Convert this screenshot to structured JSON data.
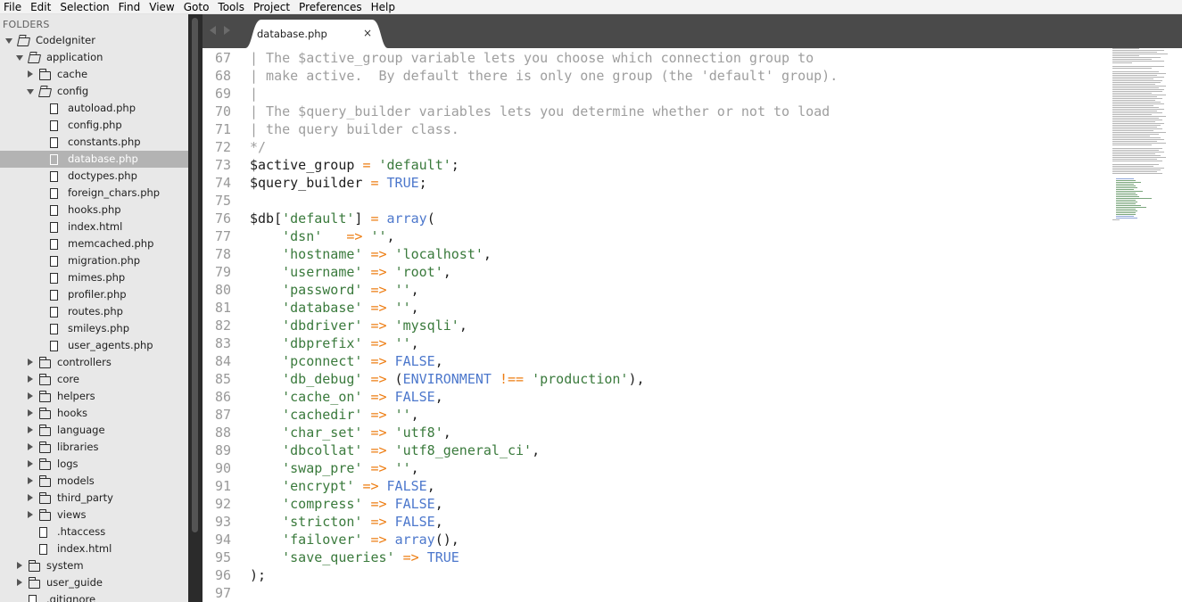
{
  "menu": [
    "File",
    "Edit",
    "Selection",
    "Find",
    "View",
    "Goto",
    "Tools",
    "Project",
    "Preferences",
    "Help"
  ],
  "sidebar": {
    "header": "FOLDERS",
    "tree": [
      {
        "label": "CodeIgniter",
        "type": "folder",
        "expanded": true,
        "depth": 0
      },
      {
        "label": "application",
        "type": "folder",
        "expanded": true,
        "depth": 1
      },
      {
        "label": "cache",
        "type": "folder",
        "expanded": false,
        "depth": 2
      },
      {
        "label": "config",
        "type": "folder",
        "expanded": true,
        "depth": 2
      },
      {
        "label": "autoload.php",
        "type": "file",
        "depth": 3
      },
      {
        "label": "config.php",
        "type": "file",
        "depth": 3
      },
      {
        "label": "constants.php",
        "type": "file",
        "depth": 3
      },
      {
        "label": "database.php",
        "type": "file",
        "depth": 3,
        "selected": true
      },
      {
        "label": "doctypes.php",
        "type": "file",
        "depth": 3
      },
      {
        "label": "foreign_chars.php",
        "type": "file",
        "depth": 3
      },
      {
        "label": "hooks.php",
        "type": "file",
        "depth": 3
      },
      {
        "label": "index.html",
        "type": "file",
        "depth": 3
      },
      {
        "label": "memcached.php",
        "type": "file",
        "depth": 3
      },
      {
        "label": "migration.php",
        "type": "file",
        "depth": 3
      },
      {
        "label": "mimes.php",
        "type": "file",
        "depth": 3
      },
      {
        "label": "profiler.php",
        "type": "file",
        "depth": 3
      },
      {
        "label": "routes.php",
        "type": "file",
        "depth": 3
      },
      {
        "label": "smileys.php",
        "type": "file",
        "depth": 3
      },
      {
        "label": "user_agents.php",
        "type": "file",
        "depth": 3
      },
      {
        "label": "controllers",
        "type": "folder",
        "expanded": false,
        "depth": 2
      },
      {
        "label": "core",
        "type": "folder",
        "expanded": false,
        "depth": 2
      },
      {
        "label": "helpers",
        "type": "folder",
        "expanded": false,
        "depth": 2
      },
      {
        "label": "hooks",
        "type": "folder",
        "expanded": false,
        "depth": 2
      },
      {
        "label": "language",
        "type": "folder",
        "expanded": false,
        "depth": 2
      },
      {
        "label": "libraries",
        "type": "folder",
        "expanded": false,
        "depth": 2
      },
      {
        "label": "logs",
        "type": "folder",
        "expanded": false,
        "depth": 2
      },
      {
        "label": "models",
        "type": "folder",
        "expanded": false,
        "depth": 2
      },
      {
        "label": "third_party",
        "type": "folder",
        "expanded": false,
        "depth": 2
      },
      {
        "label": "views",
        "type": "folder",
        "expanded": false,
        "depth": 2
      },
      {
        "label": ".htaccess",
        "type": "file",
        "depth": 2
      },
      {
        "label": "index.html",
        "type": "file",
        "depth": 2
      },
      {
        "label": "system",
        "type": "folder",
        "expanded": false,
        "depth": 1
      },
      {
        "label": "user_guide",
        "type": "folder",
        "expanded": false,
        "depth": 1
      },
      {
        "label": ".gitignore",
        "type": "file",
        "depth": 1
      }
    ]
  },
  "tab": {
    "title": "database.php",
    "close": "×"
  },
  "colors": {
    "comment": "#9e9e9e",
    "string": "#3a7a3c",
    "operator": "#ed7d12",
    "keyword": "#4d78cc",
    "line_number": "#999999",
    "sidebar_bg": "#e8e8e8",
    "tabbar_bg": "#4a4a4a"
  },
  "editor": {
    "lines": [
      {
        "n": "67",
        "t": [
          [
            "c",
            "| The $active_group variable lets you choose which connection group to"
          ]
        ]
      },
      {
        "n": "68",
        "t": [
          [
            "c",
            "| make active.  By default there is only one group (the 'default' group)."
          ]
        ]
      },
      {
        "n": "69",
        "t": [
          [
            "c",
            "|"
          ]
        ]
      },
      {
        "n": "70",
        "t": [
          [
            "c",
            "| The $query_builder variables lets you determine whether or not to load"
          ]
        ]
      },
      {
        "n": "71",
        "t": [
          [
            "c",
            "| the query builder class."
          ]
        ]
      },
      {
        "n": "72",
        "t": [
          [
            "c",
            "*/"
          ]
        ]
      },
      {
        "n": "73",
        "t": [
          [
            "v",
            "$active_group"
          ],
          [
            "p",
            " "
          ],
          [
            "o",
            "="
          ],
          [
            "p",
            " "
          ],
          [
            "s",
            "'default'"
          ],
          [
            "p",
            ";"
          ]
        ]
      },
      {
        "n": "74",
        "t": [
          [
            "v",
            "$query_builder"
          ],
          [
            "p",
            " "
          ],
          [
            "o",
            "="
          ],
          [
            "p",
            " "
          ],
          [
            "k",
            "TRUE"
          ],
          [
            "p",
            ";"
          ]
        ]
      },
      {
        "n": "75",
        "t": []
      },
      {
        "n": "76",
        "t": [
          [
            "v",
            "$db"
          ],
          [
            "p",
            "["
          ],
          [
            "s",
            "'default'"
          ],
          [
            "p",
            "] "
          ],
          [
            "o",
            "="
          ],
          [
            "p",
            " "
          ],
          [
            "k",
            "array"
          ],
          [
            "p",
            "("
          ]
        ]
      },
      {
        "n": "77",
        "t": [
          [
            "p",
            "    "
          ],
          [
            "s",
            "'dsn'"
          ],
          [
            "p",
            "   "
          ],
          [
            "o",
            "=>"
          ],
          [
            "p",
            " "
          ],
          [
            "s",
            "''"
          ],
          [
            "p",
            ","
          ]
        ]
      },
      {
        "n": "78",
        "t": [
          [
            "p",
            "    "
          ],
          [
            "s",
            "'hostname'"
          ],
          [
            "p",
            " "
          ],
          [
            "o",
            "=>"
          ],
          [
            "p",
            " "
          ],
          [
            "s",
            "'localhost'"
          ],
          [
            "p",
            ","
          ]
        ]
      },
      {
        "n": "79",
        "t": [
          [
            "p",
            "    "
          ],
          [
            "s",
            "'username'"
          ],
          [
            "p",
            " "
          ],
          [
            "o",
            "=>"
          ],
          [
            "p",
            " "
          ],
          [
            "s",
            "'root'"
          ],
          [
            "p",
            ","
          ]
        ]
      },
      {
        "n": "80",
        "t": [
          [
            "p",
            "    "
          ],
          [
            "s",
            "'password'"
          ],
          [
            "p",
            " "
          ],
          [
            "o",
            "=>"
          ],
          [
            "p",
            " "
          ],
          [
            "s",
            "''"
          ],
          [
            "p",
            ","
          ]
        ]
      },
      {
        "n": "81",
        "t": [
          [
            "p",
            "    "
          ],
          [
            "s",
            "'database'"
          ],
          [
            "p",
            " "
          ],
          [
            "o",
            "=>"
          ],
          [
            "p",
            " "
          ],
          [
            "s",
            "''"
          ],
          [
            "p",
            ","
          ]
        ]
      },
      {
        "n": "82",
        "t": [
          [
            "p",
            "    "
          ],
          [
            "s",
            "'dbdriver'"
          ],
          [
            "p",
            " "
          ],
          [
            "o",
            "=>"
          ],
          [
            "p",
            " "
          ],
          [
            "s",
            "'mysqli'"
          ],
          [
            "p",
            ","
          ]
        ]
      },
      {
        "n": "83",
        "t": [
          [
            "p",
            "    "
          ],
          [
            "s",
            "'dbprefix'"
          ],
          [
            "p",
            " "
          ],
          [
            "o",
            "=>"
          ],
          [
            "p",
            " "
          ],
          [
            "s",
            "''"
          ],
          [
            "p",
            ","
          ]
        ]
      },
      {
        "n": "84",
        "t": [
          [
            "p",
            "    "
          ],
          [
            "s",
            "'pconnect'"
          ],
          [
            "p",
            " "
          ],
          [
            "o",
            "=>"
          ],
          [
            "p",
            " "
          ],
          [
            "k",
            "FALSE"
          ],
          [
            "p",
            ","
          ]
        ]
      },
      {
        "n": "85",
        "t": [
          [
            "p",
            "    "
          ],
          [
            "s",
            "'db_debug'"
          ],
          [
            "p",
            " "
          ],
          [
            "o",
            "=>"
          ],
          [
            "p",
            " ("
          ],
          [
            "k",
            "ENVIRONMENT"
          ],
          [
            "p",
            " "
          ],
          [
            "o",
            "!=="
          ],
          [
            "p",
            " "
          ],
          [
            "s",
            "'production'"
          ],
          [
            "p",
            "),"
          ]
        ]
      },
      {
        "n": "86",
        "t": [
          [
            "p",
            "    "
          ],
          [
            "s",
            "'cache_on'"
          ],
          [
            "p",
            " "
          ],
          [
            "o",
            "=>"
          ],
          [
            "p",
            " "
          ],
          [
            "k",
            "FALSE"
          ],
          [
            "p",
            ","
          ]
        ]
      },
      {
        "n": "87",
        "t": [
          [
            "p",
            "    "
          ],
          [
            "s",
            "'cachedir'"
          ],
          [
            "p",
            " "
          ],
          [
            "o",
            "=>"
          ],
          [
            "p",
            " "
          ],
          [
            "s",
            "''"
          ],
          [
            "p",
            ","
          ]
        ]
      },
      {
        "n": "88",
        "t": [
          [
            "p",
            "    "
          ],
          [
            "s",
            "'char_set'"
          ],
          [
            "p",
            " "
          ],
          [
            "o",
            "=>"
          ],
          [
            "p",
            " "
          ],
          [
            "s",
            "'utf8'"
          ],
          [
            "p",
            ","
          ]
        ]
      },
      {
        "n": "89",
        "t": [
          [
            "p",
            "    "
          ],
          [
            "s",
            "'dbcollat'"
          ],
          [
            "p",
            " "
          ],
          [
            "o",
            "=>"
          ],
          [
            "p",
            " "
          ],
          [
            "s",
            "'utf8_general_ci'"
          ],
          [
            "p",
            ","
          ]
        ]
      },
      {
        "n": "90",
        "t": [
          [
            "p",
            "    "
          ],
          [
            "s",
            "'swap_pre'"
          ],
          [
            "p",
            " "
          ],
          [
            "o",
            "=>"
          ],
          [
            "p",
            " "
          ],
          [
            "s",
            "''"
          ],
          [
            "p",
            ","
          ]
        ]
      },
      {
        "n": "91",
        "t": [
          [
            "p",
            "    "
          ],
          [
            "s",
            "'encrypt'"
          ],
          [
            "p",
            " "
          ],
          [
            "o",
            "=>"
          ],
          [
            "p",
            " "
          ],
          [
            "k",
            "FALSE"
          ],
          [
            "p",
            ","
          ]
        ]
      },
      {
        "n": "92",
        "t": [
          [
            "p",
            "    "
          ],
          [
            "s",
            "'compress'"
          ],
          [
            "p",
            " "
          ],
          [
            "o",
            "=>"
          ],
          [
            "p",
            " "
          ],
          [
            "k",
            "FALSE"
          ],
          [
            "p",
            ","
          ]
        ]
      },
      {
        "n": "93",
        "t": [
          [
            "p",
            "    "
          ],
          [
            "s",
            "'stricton'"
          ],
          [
            "p",
            " "
          ],
          [
            "o",
            "=>"
          ],
          [
            "p",
            " "
          ],
          [
            "k",
            "FALSE"
          ],
          [
            "p",
            ","
          ]
        ]
      },
      {
        "n": "94",
        "t": [
          [
            "p",
            "    "
          ],
          [
            "s",
            "'failover'"
          ],
          [
            "p",
            " "
          ],
          [
            "o",
            "=>"
          ],
          [
            "p",
            " "
          ],
          [
            "k",
            "array"
          ],
          [
            "p",
            "(),"
          ]
        ]
      },
      {
        "n": "95",
        "t": [
          [
            "p",
            "    "
          ],
          [
            "s",
            "'save_queries'"
          ],
          [
            "p",
            " "
          ],
          [
            "o",
            "=>"
          ],
          [
            "p",
            " "
          ],
          [
            "k",
            "TRUE"
          ]
        ]
      },
      {
        "n": "96",
        "t": [
          [
            "p",
            ");"
          ]
        ]
      },
      {
        "n": "97",
        "t": []
      }
    ]
  }
}
